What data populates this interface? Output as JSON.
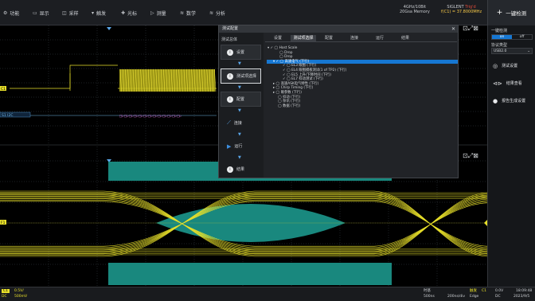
{
  "menu": [
    {
      "icon": "gear-icon",
      "glyph": "⚙",
      "label": "功能"
    },
    {
      "icon": "display-icon",
      "glyph": "▭",
      "label": "显示"
    },
    {
      "icon": "acquire-icon",
      "glyph": "◫",
      "label": "采样"
    },
    {
      "icon": "trigger-icon",
      "glyph": "▾",
      "label": "触发"
    },
    {
      "icon": "cursor-icon",
      "glyph": "✚",
      "label": "光标"
    },
    {
      "icon": "measure-icon",
      "glyph": "▷",
      "label": "测量"
    },
    {
      "icon": "math-icon",
      "glyph": "≋",
      "label": "数学"
    },
    {
      "icon": "analysis-icon",
      "glyph": "≋",
      "label": "分析"
    }
  ],
  "status": {
    "spec1": "4GHz/10Bit",
    "spec2": "20Gsa Memory",
    "brand": "SIGLENT",
    "trig_state": "Trig'd",
    "freq_label": "f(C1) = 37.8000MHz"
  },
  "onekey": {
    "icon": "plus-icon",
    "label": "一键检测"
  },
  "scope": {
    "c1_tag": "C1",
    "s1_tag": "S1 I2C",
    "f1_tag": "F1",
    "decode_text": "□▷□▷□▷□▷□▷□▷□▷□▷□▷□▷□▷□▷□▷"
  },
  "dialog": {
    "title": "测试配置",
    "close_label": "✕",
    "left_head": "测试总体",
    "side": [
      {
        "icon": "info-icon",
        "glyph": "i",
        "label": "设置"
      },
      {
        "icon": "info-icon",
        "glyph": "i",
        "label": "测试项选择"
      },
      {
        "icon": "info-icon",
        "glyph": "i",
        "label": "配置"
      },
      {
        "icon": "connect-icon",
        "glyph": "⟋",
        "label": "连接"
      },
      {
        "icon": "play-icon",
        "glyph": "▶",
        "label": "运行"
      },
      {
        "icon": "info-icon",
        "glyph": "i",
        "label": "结果"
      }
    ],
    "tabs": [
      "设置",
      "测试项选择",
      "配置",
      "连接",
      "运行",
      "结果"
    ],
    "tree": [
      "▾ ✓ ◯ Host Scale",
      "◯ Drop",
      "◯ Drop",
      "▾ ✓ ◯ 高速电气 (下行)",
      "✓ ◯ EL3 眼图 (下行)",
      "✓ ◯ EL4 眼图模板测试(1 of TP2) (下行)",
      "✓ ◯ EL5 上升/下降时间 (下行)",
      "✓ ◯ EL7 抖动测试 (下行)",
      "▸ ◯ 高速ASK电气特性 (下行)",
      "▸ ◯ Chirp Timing (下行)",
      "▸ ◯ 眼参数 (下行)",
      "◯ 抖动 (下行)",
      "◯ 杂讯 (下行)",
      "◯ 数据 (下行)"
    ]
  },
  "panel": {
    "title": "一键检测",
    "toggle_on": "on",
    "toggle_off": "off",
    "type_label": "协议类型",
    "type_value": "USB2.0",
    "buttons": [
      {
        "icon": "settings-icon",
        "glyph": "◎",
        "label": "测试设置"
      },
      {
        "icon": "result-icon",
        "glyph": "⊲⊳",
        "label": "结果查看"
      },
      {
        "icon": "info-icon",
        "glyph": "●",
        "label": "报告生成设置"
      }
    ]
  },
  "bottom": {
    "ch1_name": "C1",
    "ch1_scale": "0.5V/",
    "ch1_coupling": "DC",
    "ch1_offset": "500mV",
    "tb_label": "时基",
    "tb_value1": "500ns",
    "tb_value2": "200ns/div",
    "trig_label": "触发",
    "trig_mode": "Edge",
    "trig_src": "C1",
    "trig_level": "0.0V",
    "trig_coupling": "DC",
    "time_label": "18:09:48",
    "date_label": "2023/9/5"
  },
  "colors": {
    "ch1": "#e8e02a",
    "mask": "#19887e",
    "accent": "#1677d2",
    "grid": "#3b4047"
  }
}
